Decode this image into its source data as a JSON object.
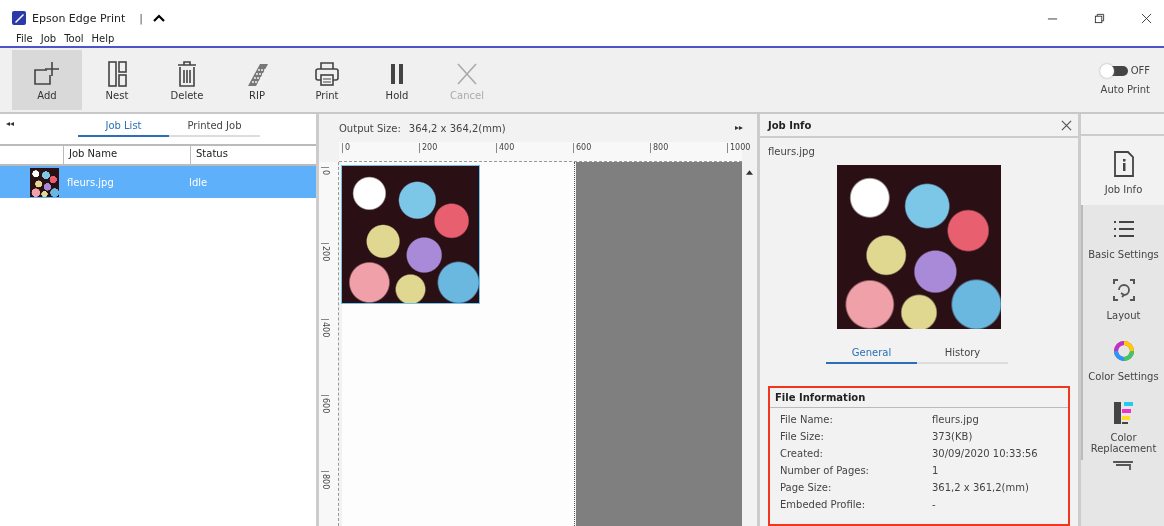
{
  "window": {
    "title": "Epson Edge Print",
    "separator": "|"
  },
  "menu": [
    "File",
    "Job",
    "Tool",
    "Help"
  ],
  "toolbar": [
    {
      "label": "Add",
      "kind": "add",
      "selected": true,
      "disabled": false
    },
    {
      "label": "Nest",
      "kind": "nest",
      "selected": false,
      "disabled": false
    },
    {
      "label": "Delete",
      "kind": "delete",
      "selected": false,
      "disabled": false
    },
    {
      "label": "RIP",
      "kind": "rip",
      "selected": false,
      "disabled": false
    },
    {
      "label": "Print",
      "kind": "print",
      "selected": false,
      "disabled": false
    },
    {
      "label": "Hold",
      "kind": "hold",
      "selected": false,
      "disabled": false
    },
    {
      "label": "Cancel",
      "kind": "cancel",
      "selected": false,
      "disabled": true
    }
  ],
  "auto_print": {
    "state": "OFF",
    "on": false,
    "label": "Auto Print"
  },
  "job_panel": {
    "tabs": [
      {
        "label": "Job List",
        "selected": true
      },
      {
        "label": "Printed Job",
        "selected": false
      }
    ],
    "columns": [
      "Job Name",
      "Status"
    ],
    "rows": [
      {
        "name": "fleurs.jpg",
        "status": "Idle",
        "selected": true
      }
    ]
  },
  "canvas": {
    "output_label": "Output Size:",
    "output_size": "364,2 x 364,2(mm)",
    "x_ticks": [
      "0",
      "200",
      "400",
      "600",
      "800",
      "1000"
    ],
    "y_ticks": [
      "0",
      "200",
      "400",
      "600",
      "800"
    ]
  },
  "job_info": {
    "title": "Job Info",
    "file": "fleurs.jpg",
    "tabs": [
      {
        "label": "General",
        "selected": true
      },
      {
        "label": "History",
        "selected": false
      }
    ],
    "section_title": "File Information",
    "fields": [
      {
        "label": "File Name:",
        "value": "fleurs.jpg"
      },
      {
        "label": "File Size:",
        "value": "373(KB)"
      },
      {
        "label": "Created:",
        "value": "30/09/2020 10:33:56"
      },
      {
        "label": "Number of Pages:",
        "value": "1"
      },
      {
        "label": "Page Size:",
        "value": "361,2 x 361,2(mm)"
      },
      {
        "label": "Embeded Profile:",
        "value": "-"
      }
    ]
  },
  "sidebar": [
    {
      "label": "Job Info",
      "kind": "info",
      "selected": true
    },
    {
      "label": "Basic Settings",
      "kind": "list",
      "selected": false
    },
    {
      "label": "Layout",
      "kind": "layout",
      "selected": false
    },
    {
      "label": "Color Settings",
      "kind": "color",
      "selected": false
    },
    {
      "label": "Color Replacement",
      "kind": "replace",
      "selected": false
    }
  ]
}
